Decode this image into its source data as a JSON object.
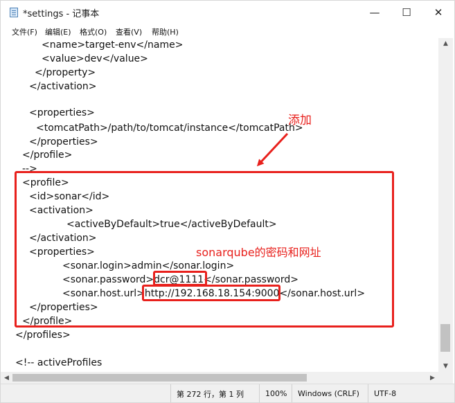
{
  "window": {
    "title": "*settings - 记事本"
  },
  "controls": {
    "minimize": "—",
    "maximize": "☐",
    "close": "✕"
  },
  "menu": {
    "items": [
      "文件(F)",
      "编辑(E)",
      "格式(O)",
      "查看(V)",
      "帮助(H)"
    ]
  },
  "editor": {
    "lines": [
      "<name>target-env</name>",
      "<value>dev</value>",
      "</property>",
      "</activation>",
      "",
      "<properties>",
      "<tomcatPath>/path/to/tomcat/instance</tomcatPath>",
      "</properties>",
      "</profile>",
      "-->",
      "<profile>",
      "<id>sonar</id>",
      "<activation>",
      "<activeByDefault>true</activeByDefault>",
      "</activation>",
      "<properties>",
      "<sonar.login>admin</sonar.login>",
      "<sonar.password>dcr@1111</sonar.password>",
      "<sonar.host.url>http://192.168.18.154:9000</sonar.host.url>",
      "</properties>",
      "</profile>",
      "</profiles>",
      "",
      "<!-- activeProfiles"
    ]
  },
  "annotations": {
    "add_label": "添加",
    "sonar_label": "sonarqube的密码和网址"
  },
  "statusbar": {
    "position": "第 272 行，第 1 列",
    "zoom": "100%",
    "line_ending": "Windows (CRLF)",
    "encoding": "UTF-8"
  },
  "colors": {
    "annotation": "#e8201c"
  }
}
